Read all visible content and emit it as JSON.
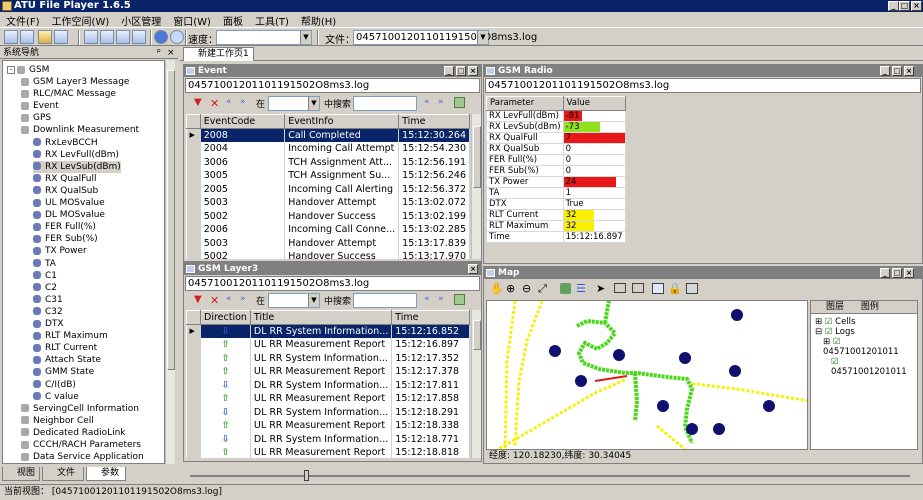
{
  "window": {
    "title": "ATU File Player 1.6.5"
  },
  "menu": [
    "文件(F)",
    "工作空间(W)",
    "小区管理",
    "窗口(W)",
    "面板",
    "工具(T)",
    "帮助(H)"
  ],
  "toolbar": {
    "speed_label": "速度：",
    "file_label": "文件：",
    "file_value": "04571001201101191502O8ms3.log"
  },
  "workspace_tab": "新建工作页1",
  "nav": {
    "title": "系统导航",
    "root": "GSM",
    "items": [
      {
        "label": "GSM Layer3 Message",
        "level": 1
      },
      {
        "label": "RLC/MAC Message",
        "level": 1
      },
      {
        "label": "Event",
        "level": 1
      },
      {
        "label": "GPS",
        "level": 1
      },
      {
        "label": "Downlink Measurement",
        "level": 1
      },
      {
        "label": "RxLevBCCH",
        "level": 2
      },
      {
        "label": "RX LevFull(dBm)",
        "level": 2
      },
      {
        "label": "RX LevSub(dBm)",
        "level": 2
      },
      {
        "label": "RX QualFull",
        "level": 2
      },
      {
        "label": "RX QualSub",
        "level": 2
      },
      {
        "label": "UL MOSvalue",
        "level": 2
      },
      {
        "label": "DL MOSvalue",
        "level": 2
      },
      {
        "label": "FER Full(%)",
        "level": 2
      },
      {
        "label": "FER Sub(%)",
        "level": 2
      },
      {
        "label": "TX Power",
        "level": 2
      },
      {
        "label": "TA",
        "level": 2
      },
      {
        "label": "C1",
        "level": 2
      },
      {
        "label": "C2",
        "level": 2
      },
      {
        "label": "C31",
        "level": 2
      },
      {
        "label": "C32",
        "level": 2
      },
      {
        "label": "DTX",
        "level": 2
      },
      {
        "label": "RLT Maximum",
        "level": 2
      },
      {
        "label": "RLT Current",
        "level": 2
      },
      {
        "label": "Attach State",
        "level": 2
      },
      {
        "label": "GMM State",
        "level": 2
      },
      {
        "label": "C/I(dB)",
        "level": 2
      },
      {
        "label": "C value",
        "level": 2
      },
      {
        "label": "ServingCell Information",
        "level": 1
      },
      {
        "label": "Neighbor Cell",
        "level": 1
      },
      {
        "label": "Dedicated RadioLink",
        "level": 1
      },
      {
        "label": "CCCH/RACH Parameters",
        "level": 1
      },
      {
        "label": "Data Service Application",
        "level": 1
      }
    ],
    "tabs": [
      "视图",
      "文件",
      "参数"
    ]
  },
  "event": {
    "title": "Event",
    "file": "04571001201101191502O8ms3.log",
    "search_in": "在",
    "search_label": "中搜索",
    "columns": [
      "EventCode",
      "EventInfo",
      "Time"
    ],
    "rows": [
      [
        "2008",
        "Call Completed",
        "15:12:30.264"
      ],
      [
        "2004",
        "Incoming Call Attempt",
        "15:12:54.230"
      ],
      [
        "3006",
        "TCH Assignment Att...",
        "15:12:56.191"
      ],
      [
        "3005",
        "TCH Assignment Su...",
        "15:12:56.246"
      ],
      [
        "2005",
        "Incoming Call Alerting",
        "15:12:56.372"
      ],
      [
        "5003",
        "Handover Attempt",
        "15:13:02.072"
      ],
      [
        "5002",
        "Handover Success",
        "15:13:02.199"
      ],
      [
        "2006",
        "Incoming Call Conne...",
        "15:13:02.285"
      ],
      [
        "5003",
        "Handover Attempt",
        "15:13:17.839"
      ],
      [
        "5002",
        "Handover Success",
        "15:13:17.970"
      ]
    ]
  },
  "layer3": {
    "title": "GSM Layer3",
    "file": "04571001201101191502O8ms3.log",
    "search_in": "在",
    "search_label": "中搜索",
    "columns": [
      "Direction",
      "Title",
      "Time"
    ],
    "rows": [
      {
        "dir": "down",
        "title": "DL RR System Information...",
        "time": "15:12:16.852"
      },
      {
        "dir": "up",
        "title": "UL RR Measurement Report",
        "time": "15:12:16.897"
      },
      {
        "dir": "up",
        "title": "UL RR System Information...",
        "time": "15:12:17.352"
      },
      {
        "dir": "up",
        "title": "UL RR Measurement Report",
        "time": "15:12:17.378"
      },
      {
        "dir": "down",
        "title": "DL RR System Information...",
        "time": "15:12:17.811"
      },
      {
        "dir": "up",
        "title": "UL RR Measurement Report",
        "time": "15:12:17.858"
      },
      {
        "dir": "down",
        "title": "DL RR System Information...",
        "time": "15:12:18.291"
      },
      {
        "dir": "up",
        "title": "UL RR Measurement Report",
        "time": "15:12:18.338"
      },
      {
        "dir": "down",
        "title": "DL RR System Information...",
        "time": "15:12:18.771"
      },
      {
        "dir": "up",
        "title": "UL RR Measurement Report",
        "time": "15:12:18.818"
      }
    ]
  },
  "radio": {
    "title": "GSM Radio",
    "file": "04571001201101191502O8ms3.log",
    "columns": [
      "Parameter",
      "Value"
    ],
    "rows": [
      {
        "p": "RX LevFull(dBm)",
        "v": "-81",
        "color": "#e81818",
        "fill": 0.3
      },
      {
        "p": "RX LevSub(dBm)",
        "v": "-73",
        "color": "#90e020",
        "fill": 0.6
      },
      {
        "p": "RX QualFull",
        "v": "7",
        "color": "#e81818",
        "fill": 1
      },
      {
        "p": "RX QualSub",
        "v": "0",
        "color": "",
        "fill": 0
      },
      {
        "p": "FER Full(%)",
        "v": "0",
        "color": "",
        "fill": 0
      },
      {
        "p": "FER Sub(%)",
        "v": "0",
        "color": "",
        "fill": 0
      },
      {
        "p": "TX Power",
        "v": "24",
        "color": "#e81818",
        "fill": 0.85
      },
      {
        "p": "TA",
        "v": "1",
        "color": "",
        "fill": 0
      },
      {
        "p": "DTX",
        "v": "True",
        "color": "",
        "fill": 0
      },
      {
        "p": "RLT Current",
        "v": "32",
        "color": "#f8f000",
        "fill": 0.5
      },
      {
        "p": "RLT Maximum",
        "v": "32",
        "color": "#f8f000",
        "fill": 0.5
      },
      {
        "p": "Time",
        "v": "15:12:16.897",
        "color": "",
        "fill": 0
      }
    ]
  },
  "map": {
    "title": "Map",
    "coords": "经度: 120.18230,纬度: 30.34045",
    "layers_tab": "图层",
    "legend_tab": "图例",
    "layers": [
      "Cells",
      "Logs",
      "04571001201011",
      "04571001201011"
    ]
  },
  "status": {
    "label": "当前视图：",
    "value": "[04571001201101191502O8ms3.log]"
  }
}
